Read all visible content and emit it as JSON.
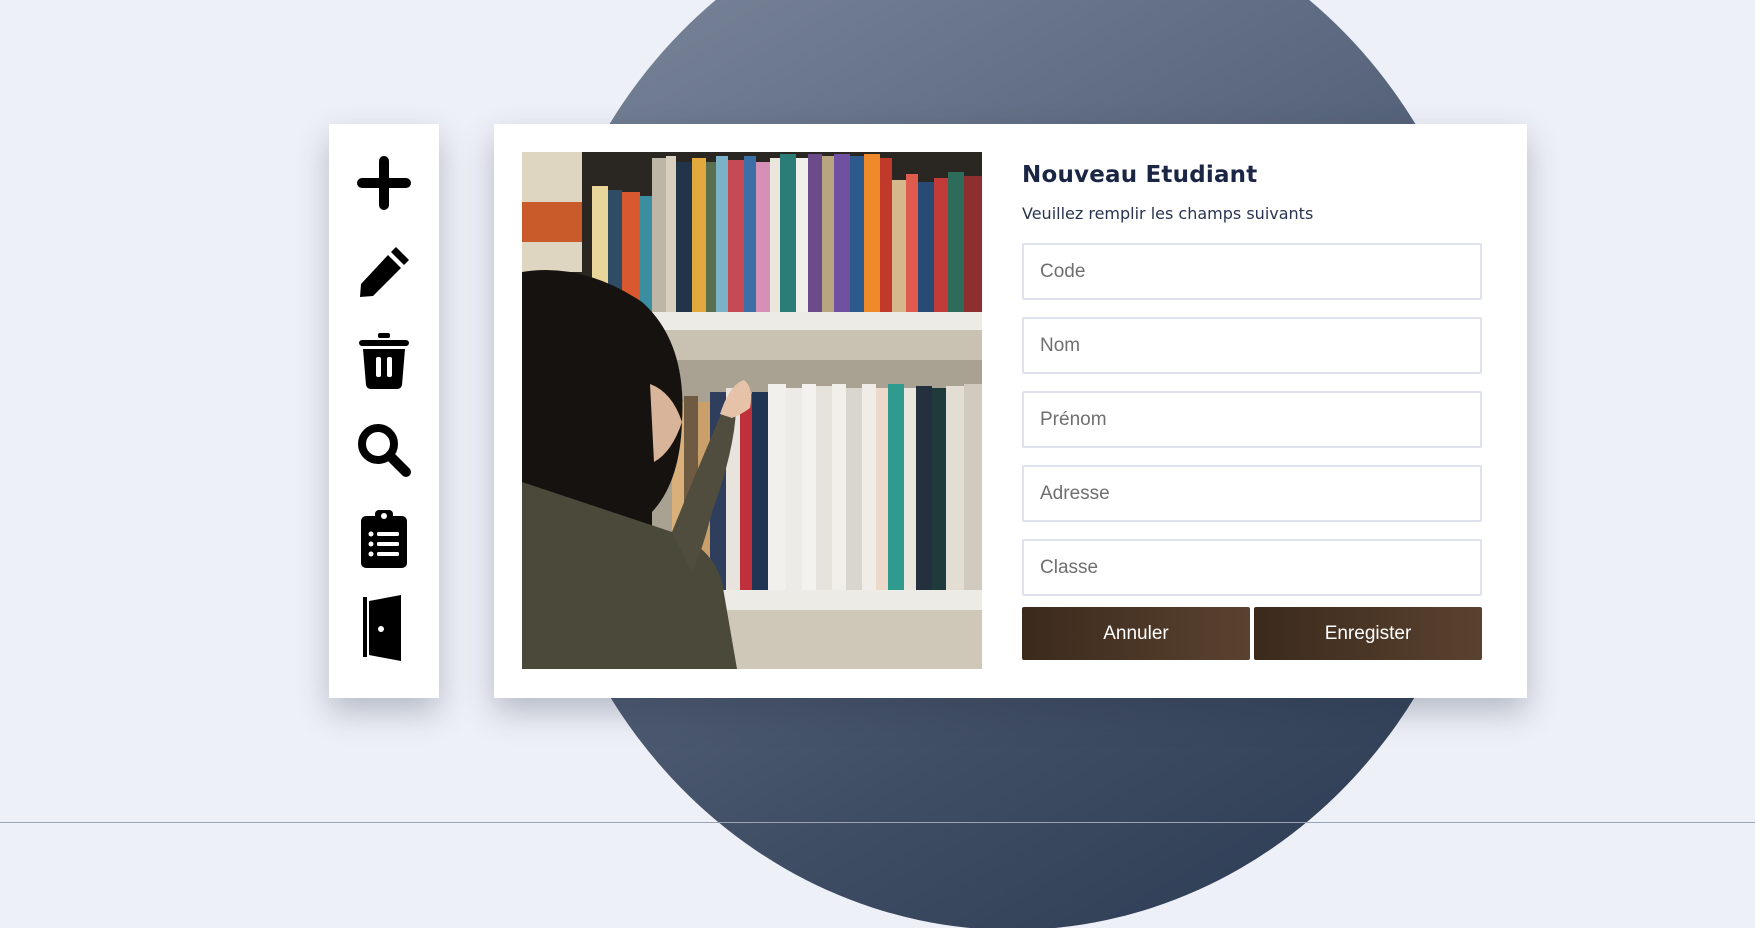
{
  "toolbar": {
    "items": [
      {
        "icon": "plus-icon"
      },
      {
        "icon": "pencil-icon"
      },
      {
        "icon": "trash-icon"
      },
      {
        "icon": "search-icon"
      },
      {
        "icon": "clipboard-list-icon"
      },
      {
        "icon": "door-icon"
      }
    ]
  },
  "form": {
    "title": "Nouveau Etudiant",
    "subtitle": "Veuillez remplir les champs suivants",
    "fields": {
      "code": {
        "placeholder": "Code",
        "value": ""
      },
      "nom": {
        "placeholder": "Nom",
        "value": ""
      },
      "prenom": {
        "placeholder": "Prénom",
        "value": ""
      },
      "adresse": {
        "placeholder": "Adresse",
        "value": ""
      },
      "classe": {
        "placeholder": "Classe",
        "value": ""
      }
    },
    "buttons": {
      "cancel": "Annuler",
      "save": "Enregister"
    }
  },
  "colors": {
    "background": "#eef0f8",
    "circle": "#4a5870",
    "button": "#4a3526",
    "title": "#1b2544"
  }
}
